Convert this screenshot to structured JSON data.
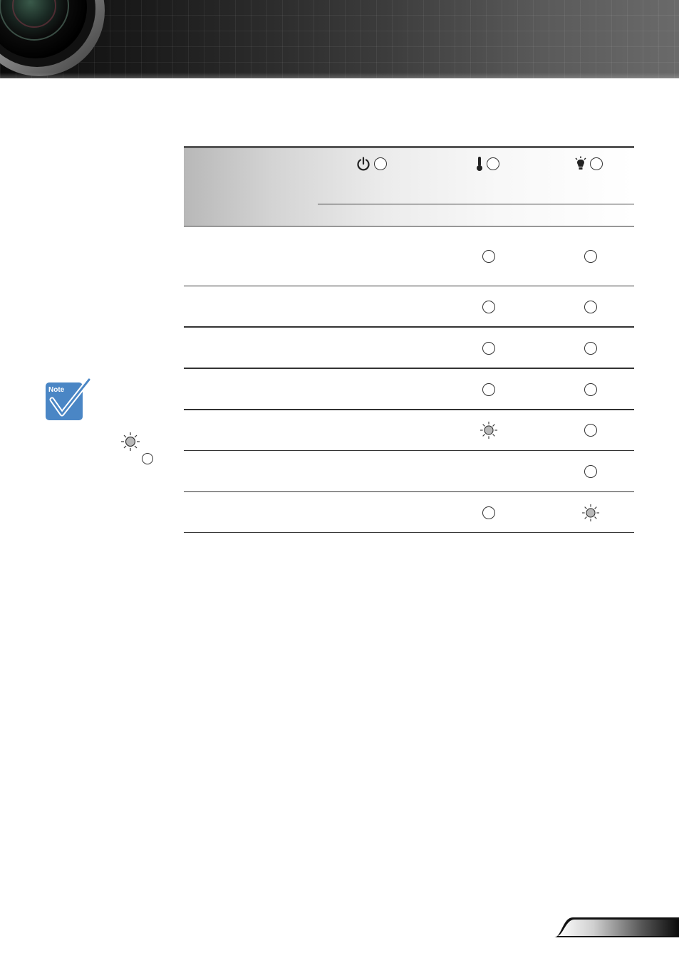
{
  "header": {
    "image": "projector-lens-banner"
  },
  "table": {
    "columns": [
      {
        "icon": "power-icon"
      },
      {
        "icon": "thermometer-icon"
      },
      {
        "icon": "lamp-icon"
      }
    ],
    "rows": [
      {
        "temp": "off",
        "lamp": "off"
      },
      {
        "temp": "off",
        "lamp": "off"
      },
      {
        "temp": "off",
        "lamp": "off"
      },
      {
        "temp": "off",
        "lamp": "off"
      },
      {
        "temp": "blinking",
        "lamp": "off"
      },
      {
        "temp": "none",
        "lamp": "off"
      },
      {
        "temp": "off",
        "lamp": "blinking"
      }
    ]
  },
  "note": {
    "badge_label": "Note",
    "legend": [
      {
        "icon": "led-blinking-icon"
      },
      {
        "icon": "led-off-icon"
      }
    ]
  },
  "colors": {
    "note_badge": "#4a86c5",
    "rule": "#333333"
  }
}
